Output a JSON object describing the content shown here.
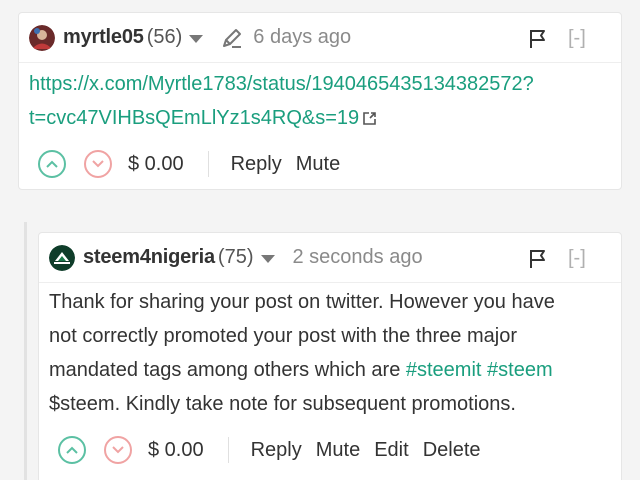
{
  "comments": [
    {
      "author": "myrtle05",
      "reputation": "(56)",
      "timeago": "6 days ago",
      "collapse_label": "[-]",
      "link_line1": "https://x.com/Myrtle1783/status/1940465435134382572?",
      "link_line2": "t=cvc47VIHBsQEmLlYz1s4RQ&s=19",
      "payout": "$ 0.00",
      "actions": {
        "reply": "Reply",
        "mute": "Mute"
      }
    },
    {
      "author": "steem4nigeria",
      "reputation": "(75)",
      "timeago": "2 seconds ago",
      "collapse_label": "[-]",
      "body_line1": "Thank for sharing your post on twitter. However you have",
      "body_line2": "not correctly promoted your post with the three major",
      "body_line3_text": "mandated tags among others which are ",
      "tag1": "#steemit",
      "tag2": "#steem",
      "body_line4": "$steem. Kindly take note for subsequent promotions.",
      "payout": "$ 0.00",
      "actions": {
        "reply": "Reply",
        "mute": "Mute",
        "edit": "Edit",
        "delete": "Delete"
      }
    }
  ],
  "colors": {
    "link": "#1a9e7e",
    "upvote": "#5bc0a3",
    "downvote": "#f0a3a3"
  },
  "icons": [
    "pencil-edited-icon",
    "flag-icon",
    "external-link-icon",
    "upvote-chevron-icon",
    "downvote-chevron-icon",
    "caret-down-icon"
  ]
}
